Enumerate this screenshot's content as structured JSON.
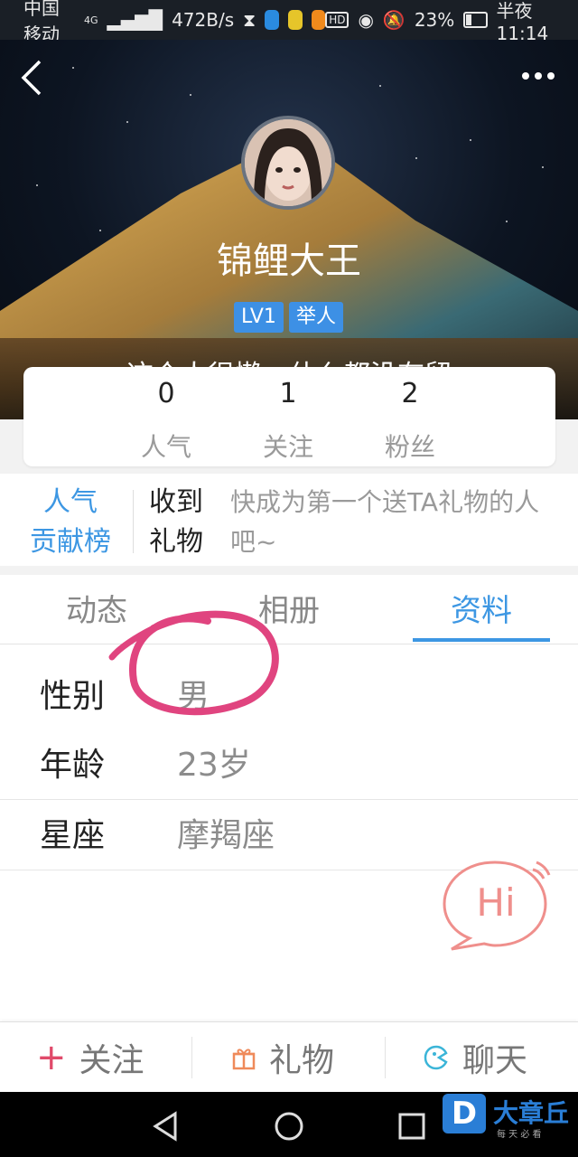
{
  "status_bar": {
    "carrier": "中国移动",
    "network": "4G",
    "speed": "472B/s",
    "battery": "23%",
    "battery_level": 0.23,
    "time": "半夜11:14",
    "icons": [
      "hourglass-icon",
      "app-icon-blue",
      "app-icon-green",
      "app-icon-orange",
      "hd-icon",
      "eye-icon",
      "mute-bell-icon",
      "battery-icon"
    ]
  },
  "header": {
    "back_icon": "chevron-left-icon",
    "more_icon": "more-dots-icon"
  },
  "profile": {
    "nickname": "锦鲤大王",
    "tags": [
      "LV1",
      "举人"
    ],
    "bio": "这个人很懒，什么都没有留"
  },
  "stats": [
    {
      "value": "0",
      "label": "人气"
    },
    {
      "value": "1",
      "label": "关注"
    },
    {
      "value": "2",
      "label": "粉丝"
    }
  ],
  "gift_section": {
    "rank_link_line1": "人气",
    "rank_link_line2": "贡献榜",
    "title_line1": "收到",
    "title_line2": "礼物",
    "prompt": "快成为第一个送TA礼物的人吧~"
  },
  "tabs": [
    {
      "label": "动态",
      "active": false
    },
    {
      "label": "相册",
      "active": false
    },
    {
      "label": "资料",
      "active": true
    }
  ],
  "info": [
    {
      "key": "性别",
      "value": "男"
    },
    {
      "key": "年龄",
      "value": "23岁"
    },
    {
      "key": "星座",
      "value": "摩羯座"
    }
  ],
  "hi_bubble": "Hi",
  "actions": [
    {
      "icon": "plus-icon",
      "label": "关注"
    },
    {
      "icon": "gift-icon",
      "label": "礼物"
    },
    {
      "icon": "chat-icon",
      "label": "聊天"
    }
  ],
  "watermark": {
    "text": "大章丘",
    "subtext": "每 天 必 看"
  },
  "colors": {
    "accent": "#3d97e3",
    "annotation": "#e0447f",
    "hi": "#ef8f8c"
  }
}
